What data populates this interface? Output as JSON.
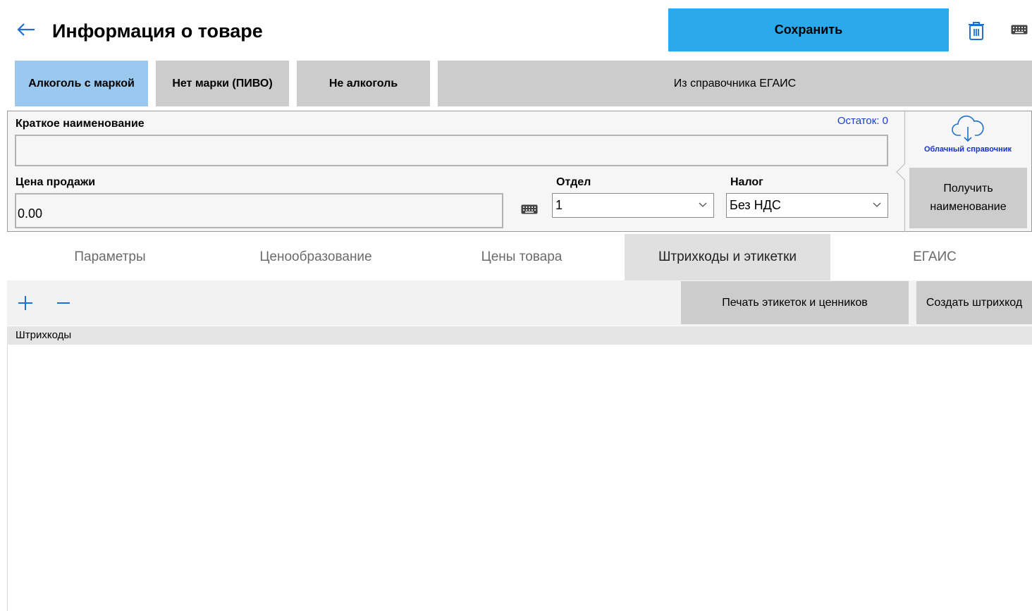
{
  "header": {
    "title": "Информация о товаре",
    "save_label": "Сохранить",
    "back_icon": "arrow-left-icon",
    "delete_icon": "trash-icon",
    "keyboard_icon": "keyboard-icon"
  },
  "type_selector": {
    "items": [
      {
        "label": "Алкоголь с маркой",
        "selected": true
      },
      {
        "label": "Нет марки (ПИВО)",
        "selected": false
      },
      {
        "label": "Не алкоголь",
        "selected": false
      },
      {
        "label": "Из справочника ЕГАИС",
        "selected": false
      }
    ]
  },
  "form": {
    "short_name_label": "Краткое наименование",
    "short_name_value": "",
    "remainder": "Остаток: 0",
    "price_label": "Цена продажи",
    "price_value": "0.00",
    "department_label": "Отдел",
    "department_value": "1",
    "tax_label": "Налог",
    "tax_value": "Без НДС"
  },
  "side": {
    "cloud_label": "Облачный справочник",
    "get_name_label": "Получить наименование"
  },
  "tabs": [
    {
      "label": "Параметры",
      "active": false
    },
    {
      "label": "Ценообразование",
      "active": false
    },
    {
      "label": "Цены товара",
      "active": false
    },
    {
      "label": "Штрихкоды и этикетки",
      "active": true
    },
    {
      "label": "ЕГАИС",
      "active": false
    }
  ],
  "toolbar": {
    "print_label": "Печать этикеток и ценников",
    "create_barcode_label": "Создать штрихкод"
  },
  "list": {
    "header": "Штрихкоды",
    "rows": []
  },
  "colors": {
    "accent": "#2aaaea",
    "selected_type": "#9ac8ef",
    "button_gray": "#cccccc",
    "link_blue": "#1a3fd6"
  }
}
